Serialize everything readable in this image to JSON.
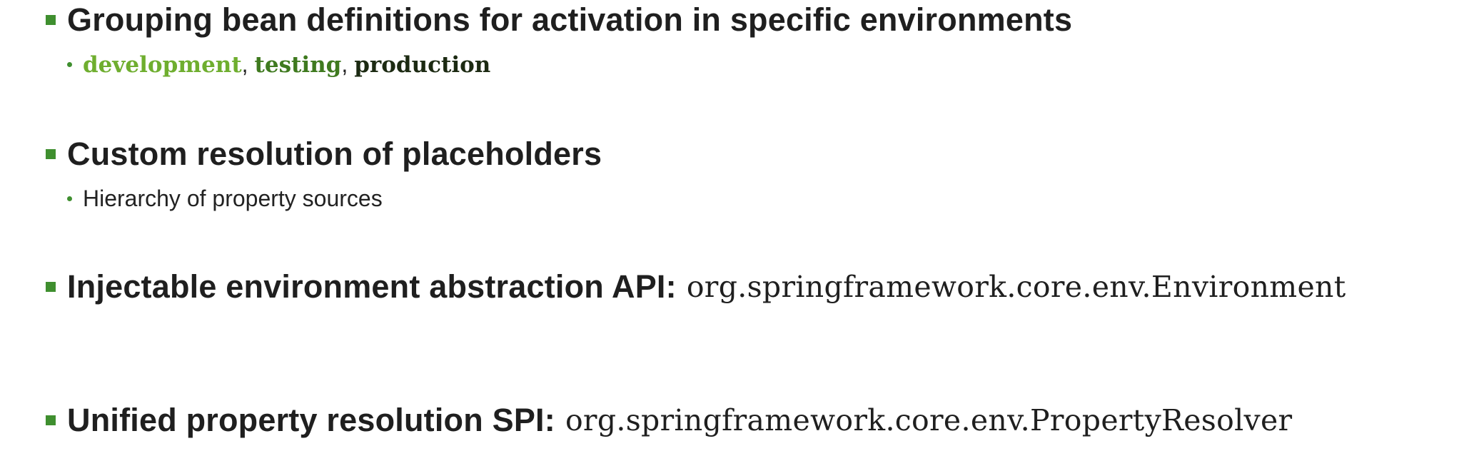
{
  "bullets": [
    {
      "text": "Grouping bean definitions for activation in specific environments",
      "sub": {
        "environments": [
          {
            "label": "development",
            "color": "#6fae2f"
          },
          {
            "label": "testing",
            "color": "#3f7a1f"
          },
          {
            "label": "production",
            "color": "#1c2a12"
          }
        ],
        "separator": ","
      }
    },
    {
      "text": "Custom resolution of placeholders",
      "sub": {
        "text": "Hierarchy of property sources"
      }
    },
    {
      "text": "Injectable environment abstraction API:",
      "code": "org.springframework.core.env.Environment"
    },
    {
      "text": "Unified property resolution SPI:",
      "code": "org.springframework.core.env.PropertyResolver"
    }
  ],
  "colors": {
    "bullet_green": "#3f8f2f"
  }
}
